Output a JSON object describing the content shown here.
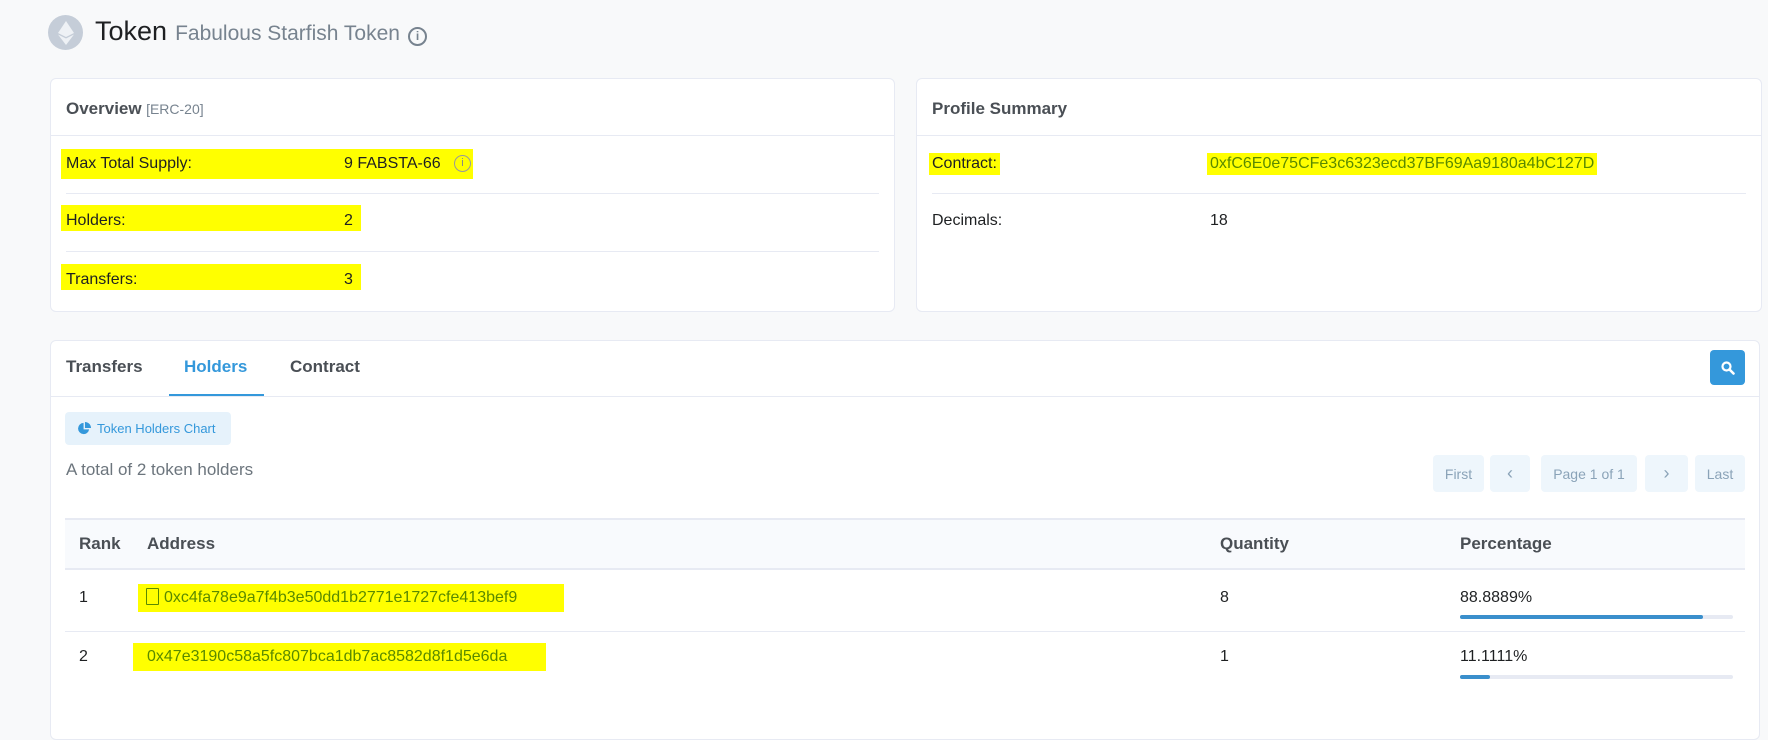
{
  "header": {
    "title": "Token",
    "subtitle": "Fabulous Starfish Token",
    "icon": "ethereum-icon"
  },
  "overview": {
    "title": "Overview",
    "standard": "[ERC-20]",
    "rows": [
      {
        "label": "Max Total Supply:",
        "value": "9 FABSTA-66"
      },
      {
        "label": "Holders:",
        "value": "2"
      },
      {
        "label": "Transfers:",
        "value": "3"
      }
    ]
  },
  "profile": {
    "title": "Profile Summary",
    "rows": [
      {
        "label": "Contract:",
        "value": "0xfC6E0e75CFe3c6323ecd37BF69Aa9180a4bC127D"
      },
      {
        "label": "Decimals:",
        "value": "18"
      }
    ]
  },
  "tabs": [
    {
      "label": "Transfers"
    },
    {
      "label": "Holders",
      "active": true
    },
    {
      "label": "Contract"
    }
  ],
  "holders": {
    "chart_button": "Token Holders Chart",
    "total_text": "A total of 2 token holders",
    "pagination": {
      "first": "First",
      "prev": "‹",
      "page": "Page 1 of 1",
      "next": "›",
      "last": "Last"
    },
    "columns": [
      "Rank",
      "Address",
      "Quantity",
      "Percentage"
    ],
    "rows": [
      {
        "rank": "1",
        "address": "0xc4fa78e9a7f4b3e50dd1b2771e1727cfe413bef9",
        "is_contract": true,
        "quantity": "8",
        "percentage": "88.8889%",
        "pct_value": 88.8889
      },
      {
        "rank": "2",
        "address": "0x47e3190c58a5fc807bca1db7ac8582d8f1d5e6da",
        "is_contract": false,
        "quantity": "1",
        "percentage": "11.1111%",
        "pct_value": 11.1111
      }
    ]
  },
  "colors": {
    "accent": "#3498db",
    "highlight": "#ffff00"
  }
}
